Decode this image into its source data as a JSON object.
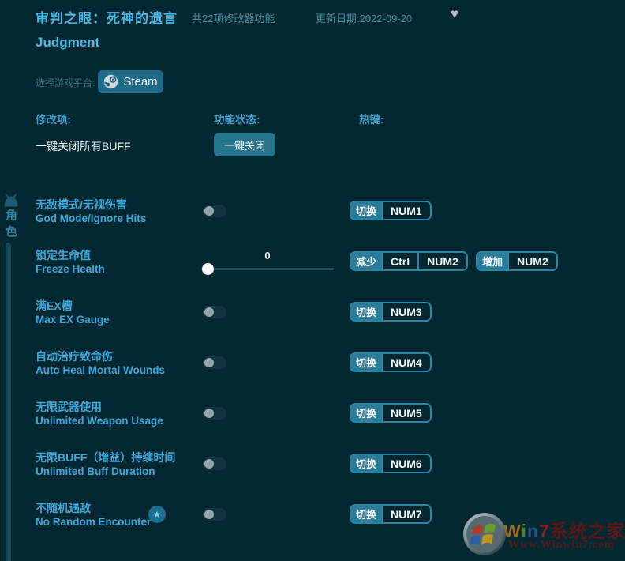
{
  "header": {
    "title_cn": "审判之眼：死神的遗言",
    "title_en": "Judgment",
    "feature_count": "共22项修改器功能",
    "update_date": "更新日期:2022-09-20",
    "heart_icon": "♥",
    "platform_label": "选择游戏平台:",
    "platform_button": "Steam"
  },
  "columns": {
    "item": "修改项:",
    "status": "功能状态:",
    "hotkey": "热键:"
  },
  "master": {
    "label": "一键关闭所有BUFF",
    "button": "一键关闭"
  },
  "sidebar": {
    "category": "角色"
  },
  "icons": {
    "star": "★"
  },
  "cheats": [
    {
      "name_cn": "无敌模式/无视伤害",
      "name_en": "God Mode/Ignore Hits",
      "state": "off",
      "hotkeys": [
        {
          "action": "切换",
          "keys": [
            "NUM1"
          ]
        }
      ]
    },
    {
      "name_cn": "锁定生命值",
      "name_en": "Freeze Health",
      "state": "0",
      "value": "0",
      "hotkeys": [
        {
          "action": "减少",
          "keys": [
            "Ctrl",
            "NUM2"
          ]
        },
        {
          "action": "增加",
          "keys": [
            "NUM2"
          ]
        }
      ]
    },
    {
      "name_cn": "满EX槽",
      "name_en": "Max EX Gauge",
      "state": "off",
      "hotkeys": [
        {
          "action": "切换",
          "keys": [
            "NUM3"
          ]
        }
      ]
    },
    {
      "name_cn": "自动治疗致命伤",
      "name_en": "Auto Heal Mortal Wounds",
      "state": "off",
      "hotkeys": [
        {
          "action": "切换",
          "keys": [
            "NUM4"
          ]
        }
      ]
    },
    {
      "name_cn": "无限武器使用",
      "name_en": "Unlimited Weapon Usage",
      "state": "off",
      "hotkeys": [
        {
          "action": "切换",
          "keys": [
            "NUM5"
          ]
        }
      ]
    },
    {
      "name_cn": "无限BUFF（增益）持续时间",
      "name_en": "Unlimited Buff Duration",
      "state": "off",
      "hotkeys": [
        {
          "action": "切换",
          "keys": [
            "NUM6"
          ]
        }
      ]
    },
    {
      "name_cn": "不随机遇敌",
      "name_en": "No Random Encounter",
      "state": "off",
      "starred": "true",
      "hotkeys": [
        {
          "action": "切换",
          "keys": [
            "NUM7"
          ]
        }
      ]
    }
  ],
  "watermark": {
    "brand_w": "W",
    "brand_i": "i",
    "brand_n": "n",
    "brand_7": "7",
    "brand_cn": "系统之家",
    "url": "Www.Winwin7.com"
  },
  "colors": {
    "background": "#042831",
    "accent_blue": "#4db7e5",
    "row_blue": "#3fa8da",
    "button_teal": "#2a7c99",
    "hotkey_border": "#2e86a6"
  }
}
